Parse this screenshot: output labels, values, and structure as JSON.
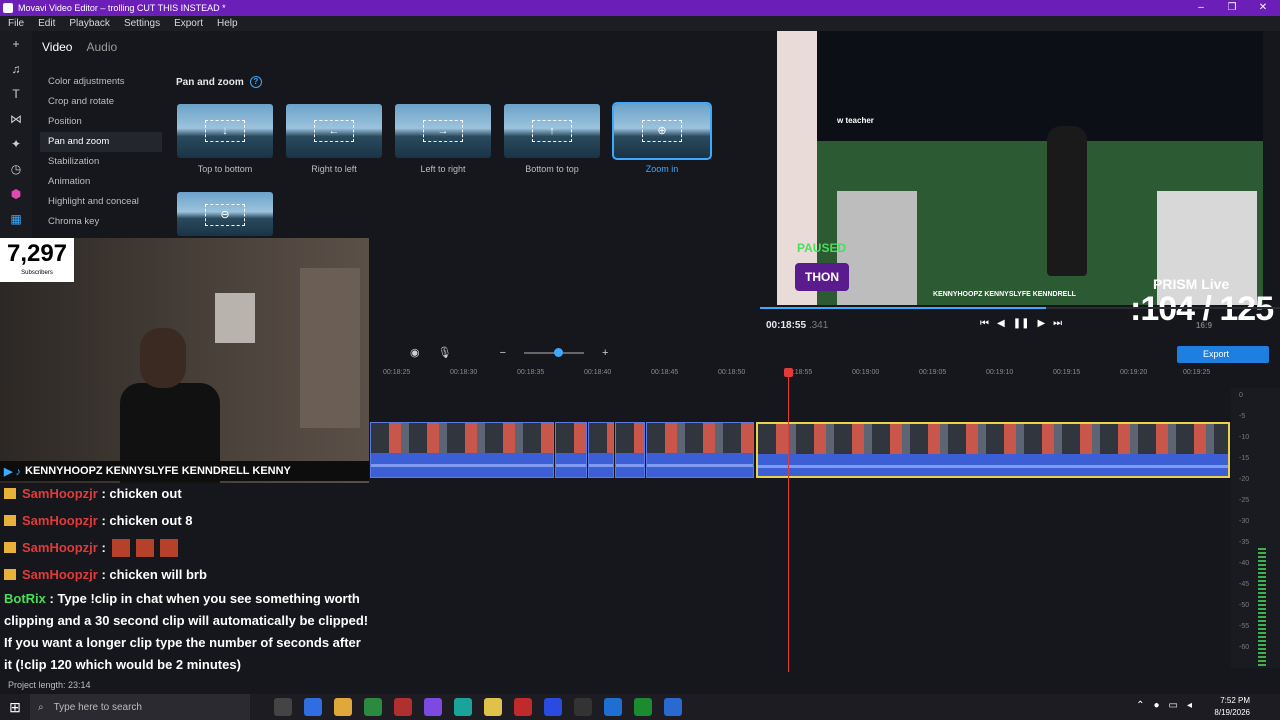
{
  "window": {
    "title": "Movavi Video Editor – trolling CUT THIS INSTEAD *",
    "min": "–",
    "restore": "❐",
    "close": "✕"
  },
  "menu": [
    "File",
    "Edit",
    "Playback",
    "Settings",
    "Export",
    "Help"
  ],
  "tabs": {
    "video": "Video",
    "audio": "Audio"
  },
  "side_menu": [
    "Color adjustments",
    "Crop and rotate",
    "Position",
    "Pan and zoom",
    "Stabilization",
    "Animation",
    "Highlight and conceal",
    "Chroma key"
  ],
  "panel": {
    "title": "Pan and zoom",
    "help": "?"
  },
  "presets": [
    {
      "label": "Top to bottom",
      "glyph": "↓"
    },
    {
      "label": "Right to left",
      "glyph": "←"
    },
    {
      "label": "Left to right",
      "glyph": "→"
    },
    {
      "label": "Bottom to top",
      "glyph": "↑"
    },
    {
      "label": "Zoom in",
      "glyph": "⊕"
    },
    {
      "label": "",
      "glyph": "⊖"
    }
  ],
  "preview": {
    "timecode": "00:18:55",
    "timecode_ms": ".341",
    "paused": "PAUSED",
    "chat_overlay": "w teacher",
    "prism": "PRISM Live",
    "counter": ":104 / 125",
    "aspect": "16:9",
    "overlay_brand": "THON",
    "overlay_socials": "KENNYHOOPZ  KENNYSLYFE  KENNDRELL"
  },
  "controls": [
    "⏮",
    "◀",
    "❚❚",
    "▶",
    "⏭"
  ],
  "stream": {
    "subs_count": "7,297",
    "subs_label": "Subscribers",
    "socials": "KENNYHOOPZ KENNYSLYFE KENNDRELL KENNY",
    "chat": [
      {
        "user": "SamHoopzjr",
        "text": ": chicken out",
        "emotes": 0
      },
      {
        "user": "SamHoopzjr",
        "text": ": chicken out 8",
        "emotes": 0
      },
      {
        "user": "SamHoopzjr",
        "text": ":",
        "emotes": 3
      },
      {
        "user": "SamHoopzjr",
        "text": ": chicken will brb",
        "emotes": 0
      }
    ],
    "bot": {
      "user": "BotRix",
      "text": ": Type !clip in chat when you see something worth clipping and a 30 second clip will automatically be clipped! If you want a longer clip type the number of seconds after it (!clip 120 which would be 2 minutes)"
    }
  },
  "timeline": {
    "ticks": [
      "00:18:25",
      "00:18:30",
      "00:18:35",
      "00:18:40",
      "00:18:45",
      "00:18:50",
      "00:18:55",
      "00:19:00",
      "00:19:05",
      "00:19:10",
      "00:19:15",
      "00:19:20",
      "00:19:25"
    ],
    "export_label": "Export",
    "zoom_minus": "−",
    "zoom_plus": "+",
    "meter_labels": [
      "0",
      "-5",
      "-10",
      "-15",
      "-20",
      "-25",
      "-30",
      "-35",
      "-40",
      "-45",
      "-50",
      "-55",
      "-60"
    ],
    "project_length": "Project length: 23:14"
  },
  "taskbar": {
    "search_placeholder": "Type here to search",
    "time": "7:52 PM",
    "date": "8/19/2026"
  },
  "colors": {
    "accent": "#3da9ff",
    "title_bar": "#6b1fb8",
    "playhead": "#e23a3a",
    "selected_clip": "#e9d44a"
  }
}
